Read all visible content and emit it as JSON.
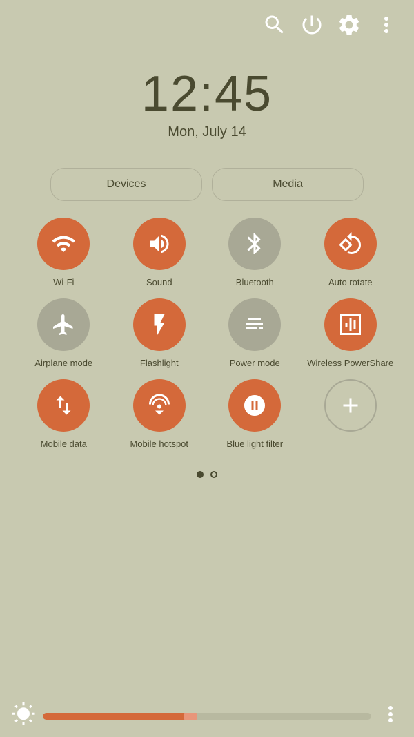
{
  "topbar": {
    "search_icon": "search",
    "power_icon": "power",
    "settings_icon": "settings",
    "more_icon": "more"
  },
  "clock": {
    "time": "12:45",
    "date": "Mon, July 14"
  },
  "tabs": {
    "devices": "Devices",
    "media": "Media"
  },
  "tiles": [
    {
      "id": "wifi",
      "label": "Wi-Fi",
      "active": true
    },
    {
      "id": "sound",
      "label": "Sound",
      "active": true
    },
    {
      "id": "bluetooth",
      "label": "Bluetooth",
      "active": false
    },
    {
      "id": "autorotate",
      "label": "Auto\nrotate",
      "active": true
    },
    {
      "id": "airplane",
      "label": "Airplane\nmode",
      "active": false
    },
    {
      "id": "flashlight",
      "label": "Flashlight",
      "active": true
    },
    {
      "id": "powermode",
      "label": "Power\nmode",
      "active": false
    },
    {
      "id": "wireless",
      "label": "Wireless\nPowerShare",
      "active": true
    },
    {
      "id": "mobiledata",
      "label": "Mobile\ndata",
      "active": true
    },
    {
      "id": "hotspot",
      "label": "Mobile\nhotspot",
      "active": true
    },
    {
      "id": "bluelight",
      "label": "Blue light\nfilter",
      "active": true
    }
  ],
  "dots": {
    "active": 0,
    "total": 2
  },
  "brightness": {
    "fill_percent": 45
  }
}
